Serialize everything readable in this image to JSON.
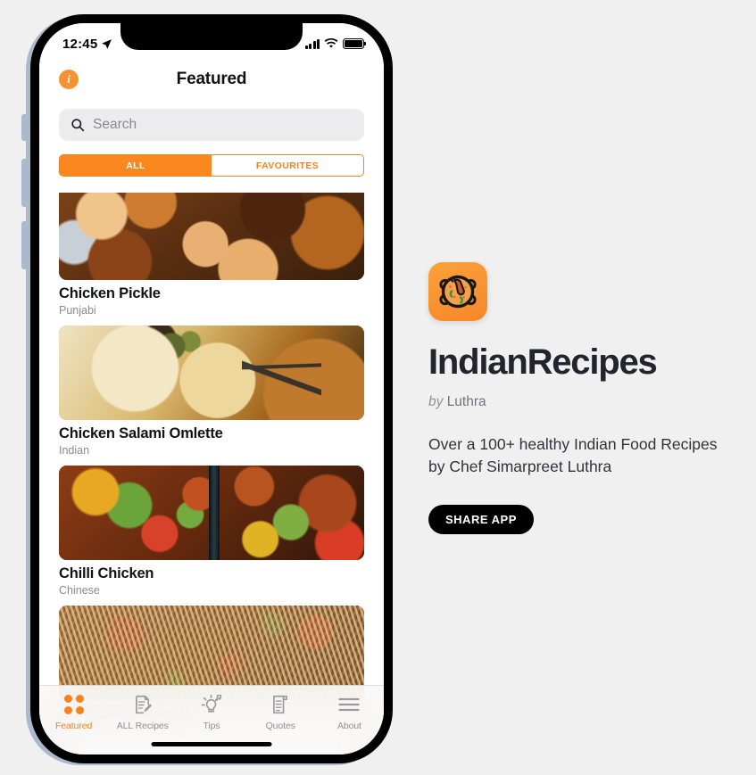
{
  "colors": {
    "accent_orange": "#F5821F",
    "accent_orange_fill": "#F9891F",
    "page_background": "#F0F0F0",
    "phone_frame": "#000000",
    "text_primary": "#22252E",
    "text_muted": "#8B8B90"
  },
  "phone": {
    "status_bar": {
      "time": "12:45",
      "location_icon": "location-arrow-icon",
      "cellular_icon": "cellular-bars-icon",
      "wifi_icon": "wifi-icon",
      "battery_icon": "battery-full-icon"
    },
    "nav": {
      "info_icon_label": "i",
      "title": "Featured"
    },
    "search": {
      "placeholder": "Search",
      "value": "",
      "icon": "search-icon"
    },
    "segmented": {
      "options": [
        {
          "label": "ALL",
          "active": true
        },
        {
          "label": "FAVOURITES",
          "active": false
        }
      ]
    },
    "recipes": [
      {
        "name": "Chicken Pickle",
        "cuisine": "Punjabi",
        "image": "chicken-pickle-photo"
      },
      {
        "name": "Chicken Salami Omlette",
        "cuisine": "Indian",
        "image": "chicken-salami-omlette-photo"
      },
      {
        "name": "Chilli Chicken",
        "cuisine": "Chinese",
        "image": "chilli-chicken-photo"
      },
      {
        "name": "Chilli Garlic Noodles",
        "cuisine": "",
        "image": "chilli-garlic-noodles-photo"
      }
    ],
    "tabbar": [
      {
        "label": "Featured",
        "icon": "grid-dots-icon",
        "active": true
      },
      {
        "label": "ALL Recipes",
        "icon": "note-pencil-icon",
        "active": false
      },
      {
        "label": "Tips",
        "icon": "lightbulb-idea-icon",
        "active": false
      },
      {
        "label": "Quotes",
        "icon": "scroll-document-icon",
        "active": false
      },
      {
        "label": "About",
        "icon": "hamburger-menu-icon",
        "active": false
      }
    ]
  },
  "info_panel": {
    "app_icon": "indian-recipes-bowl-icon",
    "app_title": "IndianRecipes",
    "byline_prefix": "by",
    "byline_author": "Luthra",
    "description": "Over a 100+ healthy Indian Food Recipes by Chef Simarpreet Luthra",
    "share_button": "SHARE APP"
  }
}
